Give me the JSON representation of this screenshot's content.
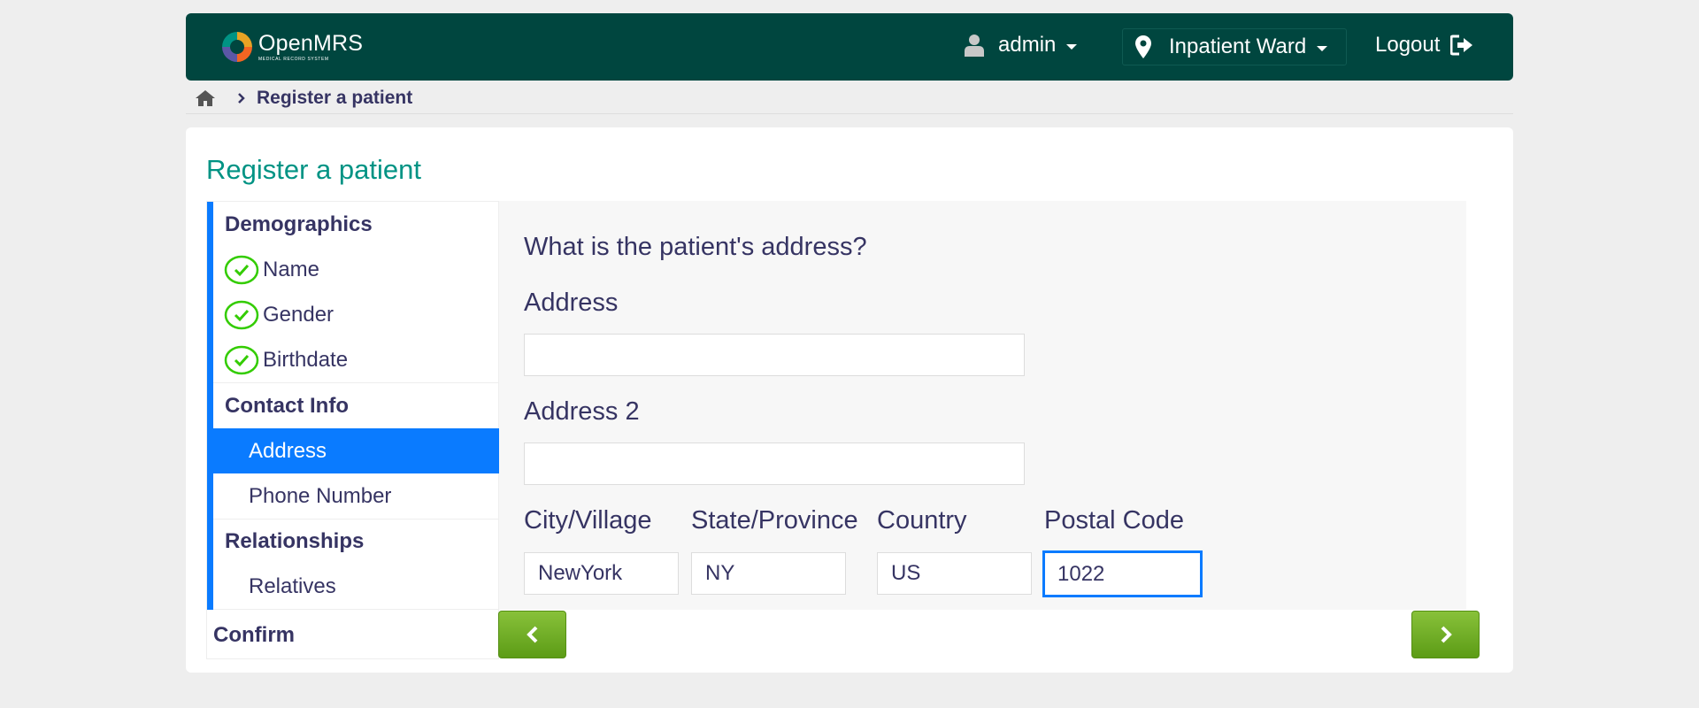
{
  "header": {
    "logo_title": "OpenMRS",
    "logo_subtitle": "MEDICAL RECORD SYSTEM",
    "user": "admin",
    "location": "Inpatient Ward",
    "logout": "Logout"
  },
  "breadcrumb": {
    "current": "Register a patient"
  },
  "page": {
    "title": "Register a patient"
  },
  "nav": {
    "sections": [
      {
        "title": "Demographics",
        "items": [
          "Name",
          "Gender",
          "Birthdate"
        ]
      },
      {
        "title": "Contact Info",
        "items": [
          "Address",
          "Phone Number"
        ]
      },
      {
        "title": "Relationships",
        "items": [
          "Relatives"
        ]
      }
    ],
    "confirm": "Confirm"
  },
  "form": {
    "question": "What is the patient's address?",
    "address_label": "Address",
    "address_value": "",
    "address2_label": "Address 2",
    "address2_value": "",
    "city_label": "City/Village",
    "city_value": "NewYork",
    "state_label": "State/Province",
    "state_value": "NY",
    "country_label": "Country",
    "country_value": "US",
    "postal_label": "Postal Code",
    "postal_value": "1022"
  },
  "colors": {
    "header_bg": "#00463f",
    "accent_blue": "#0a7bff",
    "title_teal": "#009384",
    "button_green": "#7ab52f",
    "check_green": "#33cc00"
  },
  "icons": {
    "user": "user-icon",
    "location": "map-marker-icon",
    "logout": "logout-icon",
    "home": "home-icon",
    "breadcrumb_sep": "chevron-right-icon",
    "complete": "check-circle-icon",
    "prev": "chevron-left-icon",
    "next": "chevron-right-icon"
  }
}
